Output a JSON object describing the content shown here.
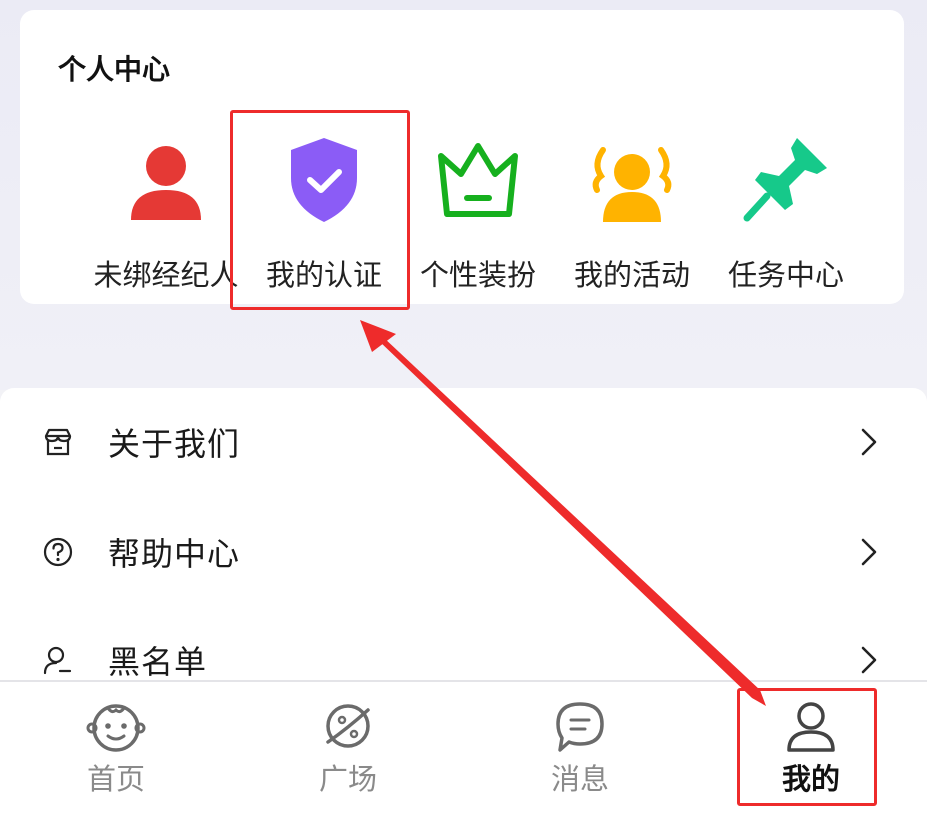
{
  "personal_center": {
    "title": "个人中心",
    "items": [
      {
        "label": "未绑经纪人",
        "icon": "person-red-icon",
        "color": "#e53935"
      },
      {
        "label": "我的认证",
        "icon": "shield-check-icon",
        "color": "#8b5cf6"
      },
      {
        "label": "个性装扮",
        "icon": "crown-icon",
        "color": "#16b01e"
      },
      {
        "label": "我的活动",
        "icon": "group-activity-icon",
        "color": "#ffb300"
      },
      {
        "label": "任务中心",
        "icon": "pushpin-icon",
        "color": "#16c98a"
      }
    ]
  },
  "menu": [
    {
      "label": "关于我们",
      "icon": "store-icon"
    },
    {
      "label": "帮助中心",
      "icon": "help-circle-icon"
    },
    {
      "label": "黑名单",
      "icon": "user-minus-icon"
    }
  ],
  "tabbar": [
    {
      "label": "首页",
      "icon": "baby-face-icon",
      "active": false
    },
    {
      "label": "广场",
      "icon": "planet-icon",
      "active": false
    },
    {
      "label": "消息",
      "icon": "chat-bubble-icon",
      "active": false
    },
    {
      "label": "我的",
      "icon": "user-icon",
      "active": true
    }
  ],
  "annotations": {
    "highlight_color": "#ee2b2b"
  }
}
